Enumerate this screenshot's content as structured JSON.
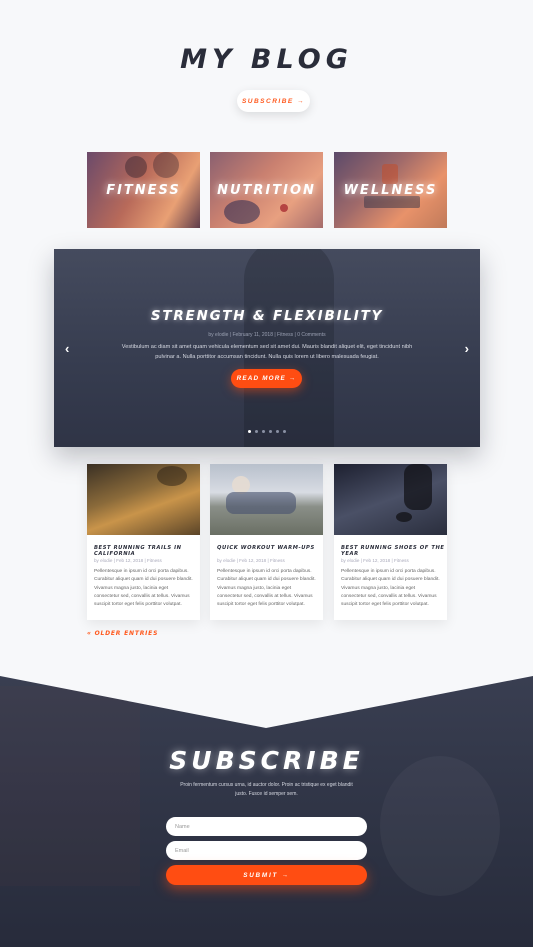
{
  "header": {
    "title": "MY BLOG",
    "subscribe_label": "SUBSCRIBE →"
  },
  "categories": [
    {
      "label": "FITNESS"
    },
    {
      "label": "NUTRITION"
    },
    {
      "label": "WELLNESS"
    }
  ],
  "slider": {
    "title": "STRENGTH & FLEXIBILITY",
    "meta": "by elodie  |  February 11, 2018  |  Fitness  |  0 Comments",
    "text": "Vestibulum ac diam sit amet quam vehicula elementum sed sit amet dui. Mauris blandit aliquet elit, eget tincidunt nibh pulvinar a. Nulla porttitor accumsan tincidunt. Nulla quis lorem ut libero malesuada feugiat.",
    "read_more": "READ MORE →",
    "prev_icon": "‹",
    "next_icon": "›",
    "dots": 6,
    "active_dot": 1
  },
  "posts": [
    {
      "title": "BEST RUNNING TRAILS IN CALIFORNIA",
      "meta": "by elodie  |  Feb 12, 2018  |  Fitness",
      "excerpt": "Pellentesque in ipsum id orci porta dapibus. Curabitur aliquet quam id dui posuere blandit. Vivamus magna justo, lacinia eget consectetur sed, convallis at tellus. Vivamus suscipit tortor eget felis porttitor volutpat."
    },
    {
      "title": "QUICK WORKOUT WARM-UPS",
      "meta": "by elodie  |  Feb 12, 2018  |  Fitness",
      "excerpt": "Pellentesque in ipsum id orci porta dapibus. Curabitur aliquet quam id dui posuere blandit. Vivamus magna justo, lacinia eget consectetur sed, convallis at tellus. Vivamus suscipit tortor eget felis porttitor volutpat."
    },
    {
      "title": "BEST RUNNING SHOES OF THE YEAR",
      "meta": "by elodie  |  Feb 12, 2018  |  Fitness",
      "excerpt": "Pellentesque in ipsum id orci porta dapibus. Curabitur aliquet quam id dui posuere blandit. Vivamus magna justo, lacinia eget consectetur sed, convallis at tellus. Vivamus suscipit tortor eget felis porttitor volutpat."
    }
  ],
  "older_entries": "« OLDER ENTRIES",
  "subscribe": {
    "title": "SUBSCRIBE",
    "text": "Proin fermentum cursus urna, id auctor dolor. Proin ac tristique ex eget blandit justo. Fusce id semper sem.",
    "name_placeholder": "Name",
    "email_placeholder": "Email",
    "submit_label": "SUBMIT →"
  },
  "colors": {
    "accent": "#ff4d12",
    "dark": "#2a2d3a",
    "background": "#f7f8fa"
  }
}
